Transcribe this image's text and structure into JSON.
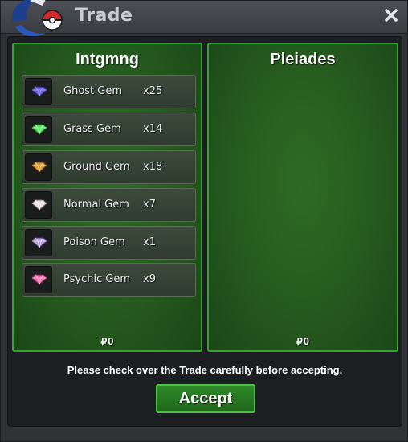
{
  "window": {
    "title": "Trade",
    "close_icon": "close-icon",
    "logo_icon": "pokeball-logo-icon"
  },
  "left_panel": {
    "player": "Intgmng",
    "money_symbol": "₽",
    "money": "0",
    "items": [
      {
        "name": "Ghost Gem",
        "qty": "x25",
        "icon": "ghost-gem-icon",
        "color": "#6b5fe0"
      },
      {
        "name": "Grass Gem",
        "qty": "x14",
        "icon": "grass-gem-icon",
        "color": "#4ee05a"
      },
      {
        "name": "Ground Gem",
        "qty": "x18",
        "icon": "ground-gem-icon",
        "color": "#d89a3a"
      },
      {
        "name": "Normal Gem",
        "qty": "x7",
        "icon": "normal-gem-icon",
        "color": "#e8dede"
      },
      {
        "name": "Poison Gem",
        "qty": "x1",
        "icon": "poison-gem-icon",
        "color": "#b9a2d8"
      },
      {
        "name": "Psychic Gem",
        "qty": "x9",
        "icon": "psychic-gem-icon",
        "color": "#f06aa8"
      }
    ]
  },
  "right_panel": {
    "player": "Pleiades",
    "money_symbol": "₽",
    "money": "0",
    "items": []
  },
  "notice": "Please check over the Trade carefully before accepting.",
  "accept_label": "Accept",
  "colors": {
    "panel_border": "#35a334",
    "panel_fill": "#285f20",
    "window_bg": "#303236"
  }
}
